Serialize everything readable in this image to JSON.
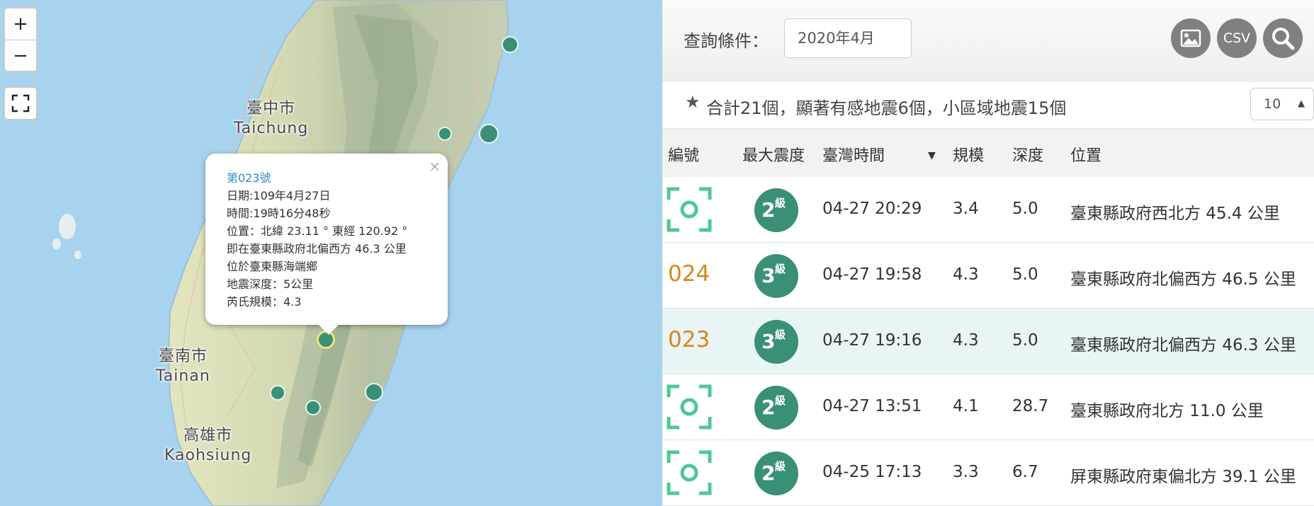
{
  "map": {
    "zoom_in": "+",
    "zoom_out": "−",
    "cities": [
      {
        "zh": "臺中市",
        "en": "Taichung"
      },
      {
        "zh": "臺南市",
        "en": "Tainan"
      },
      {
        "zh": "高雄市",
        "en": "Kaohsiung"
      }
    ],
    "popup": {
      "title": "第023號",
      "date": "日期:109年4月27日",
      "time": "時間:19時16分48秒",
      "location": "位置：北緯 23.11 ° 東經 120.92 °",
      "relative": "即在臺東縣政府北偏西方 46.3 公里",
      "township": "位於臺東縣海端鄉",
      "depth": "地震深度：5公里",
      "magnitude": "芮氏規模：4.3",
      "close": "×"
    }
  },
  "toolbar": {
    "query_label": "查詢條件：",
    "query_value": "2020年4月",
    "csv_label": "CSV"
  },
  "summary": {
    "text": "合計21個，顯著有感地震6個，小區域地震15個",
    "page_size": "10"
  },
  "table": {
    "headers": {
      "id": "編號",
      "intensity": "最大震度",
      "time": "臺灣時間",
      "magnitude": "規模",
      "depth": "深度",
      "location": "位置"
    },
    "intensity_unit": "級",
    "rows": [
      {
        "id": "",
        "intensity": "2",
        "time": "04-27 20:29",
        "magnitude": "3.4",
        "depth": "5.0",
        "location": "臺東縣政府西北方 45.4 公里"
      },
      {
        "id": "024",
        "intensity": "3",
        "time": "04-27 19:58",
        "magnitude": "4.3",
        "depth": "5.0",
        "location": "臺東縣政府北偏西方 46.5 公里"
      },
      {
        "id": "023",
        "intensity": "3",
        "time": "04-27 19:16",
        "magnitude": "4.3",
        "depth": "5.0",
        "location": "臺東縣政府北偏西方 46.3 公里"
      },
      {
        "id": "",
        "intensity": "2",
        "time": "04-27 13:51",
        "magnitude": "4.1",
        "depth": "28.7",
        "location": "臺東縣政府北方 11.0 公里"
      },
      {
        "id": "",
        "intensity": "2",
        "time": "04-25 17:13",
        "magnitude": "3.3",
        "depth": "6.7",
        "location": "屏東縣政府東偏北方 39.1 公里"
      }
    ]
  },
  "colors": {
    "accent_green": "#3a8f77",
    "id_orange": "#d9861b",
    "focus_green": "#4fc79a",
    "popup_title": "#2c8fc4"
  }
}
